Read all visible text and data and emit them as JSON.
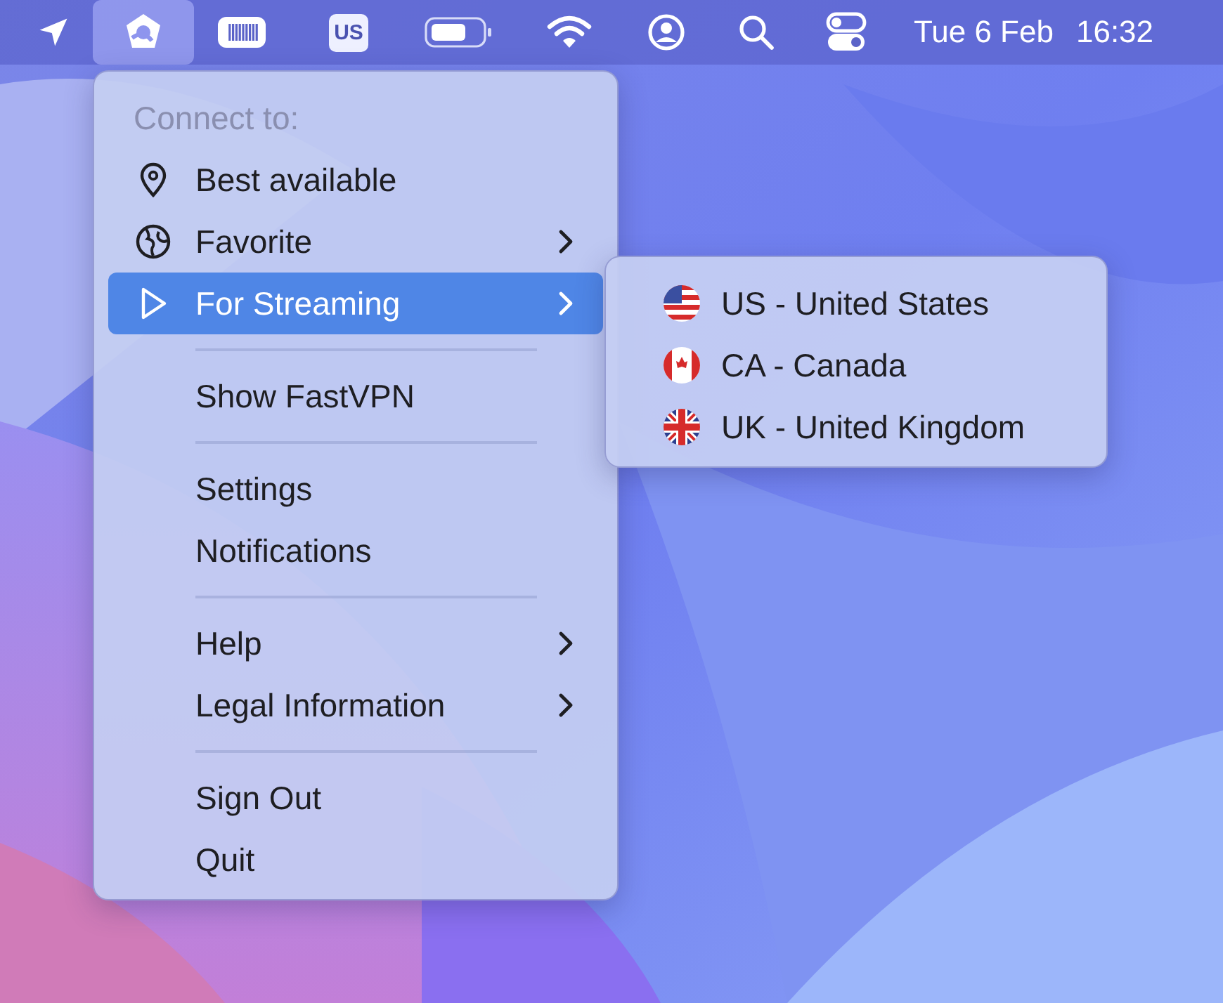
{
  "menu_bar": {
    "items": [
      {
        "kind": "location",
        "selected": false
      },
      {
        "kind": "app",
        "selected": true
      },
      {
        "kind": "keyboard",
        "selected": false
      },
      {
        "kind": "input",
        "label": "US",
        "selected": false
      },
      {
        "kind": "battery",
        "selected": false
      },
      {
        "kind": "wifi",
        "selected": false
      },
      {
        "kind": "user",
        "selected": false
      },
      {
        "kind": "search",
        "selected": false
      },
      {
        "kind": "control",
        "selected": false
      }
    ],
    "date": "Tue 6 Feb",
    "time": "16:32"
  },
  "menu": {
    "items": [
      {
        "kind": "header",
        "label": "Connect to:"
      },
      {
        "kind": "item",
        "label": "Best available",
        "selected": false,
        "submenu": false
      },
      {
        "kind": "item",
        "label": "Favorite",
        "selected": false,
        "submenu": true
      },
      {
        "kind": "item",
        "label": "For Streaming",
        "selected": true,
        "submenu": true
      },
      {
        "kind": "separator"
      },
      {
        "kind": "item",
        "label": "Show FastVPN",
        "selected": false,
        "submenu": false
      },
      {
        "kind": "separator"
      },
      {
        "kind": "item",
        "label": "Settings",
        "selected": false,
        "submenu": false
      },
      {
        "kind": "item",
        "label": "Notifications",
        "selected": false,
        "submenu": false
      },
      {
        "kind": "separator"
      },
      {
        "kind": "item",
        "label": "Help",
        "selected": false,
        "submenu": true
      },
      {
        "kind": "item",
        "label": "Legal Information",
        "selected": false,
        "submenu": true
      },
      {
        "kind": "separator"
      },
      {
        "kind": "item",
        "label": "Sign Out",
        "selected": false,
        "submenu": false
      },
      {
        "kind": "item",
        "label": "Quit",
        "selected": false,
        "submenu": false
      }
    ]
  },
  "submenu": {
    "items": [
      {
        "label": "US - United States"
      },
      {
        "label": "CA - Canada"
      },
      {
        "label": "UK - United Kingdom"
      }
    ]
  }
}
